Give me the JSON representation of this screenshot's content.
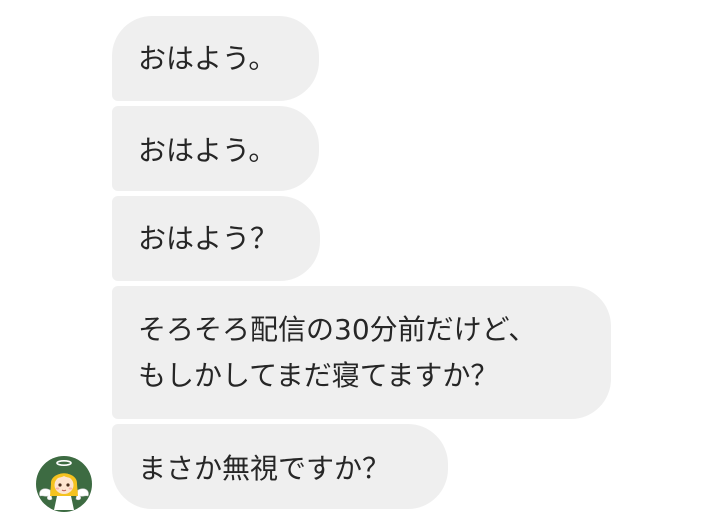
{
  "chat": {
    "sender": {
      "avatar_icon": "angel-girl-avatar"
    },
    "messages": [
      {
        "lines": [
          "おはよう。"
        ]
      },
      {
        "lines": [
          "おはよう。"
        ]
      },
      {
        "lines": [
          "おはよう？"
        ]
      },
      {
        "lines": [
          "そろそろ配信の30分前だけど、",
          "もしかしてまだ寝てますか？"
        ]
      },
      {
        "lines": [
          "まさか無視ですか？"
        ]
      }
    ],
    "colors": {
      "bubble": "#efefef",
      "text": "#262626",
      "avatar_bg": "#3d6b42"
    }
  }
}
